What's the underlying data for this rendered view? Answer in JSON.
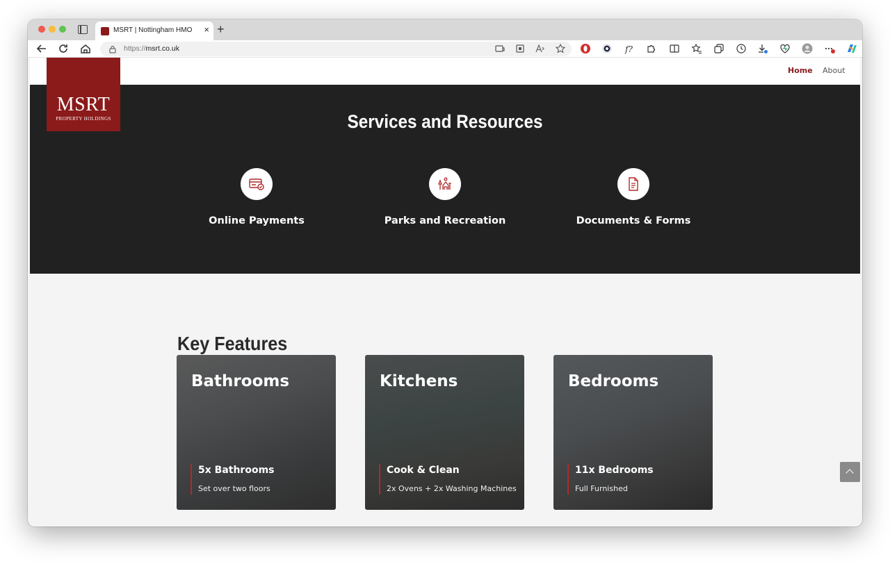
{
  "browser": {
    "tab_title": "MSRT | Nottingham HMO",
    "tab_close": "×",
    "new_tab": "+",
    "url_scheme": "https://",
    "url_host": "msrt.co.uk"
  },
  "site": {
    "logo_main": "MSRT",
    "logo_sub": "PROPERTY HOLDINGS",
    "nav": {
      "home": "Home",
      "about": "About"
    },
    "services": {
      "title": "Services and Resources",
      "items": [
        {
          "label": "Online Payments",
          "icon": "credit-card-icon"
        },
        {
          "label": "Parks and Recreation",
          "icon": "park-icon"
        },
        {
          "label": "Documents & Forms",
          "icon": "document-icon"
        }
      ]
    },
    "features": {
      "title": "Key Features",
      "cards": [
        {
          "title": "Bathrooms",
          "heading": "5x Bathrooms",
          "subtitle": "Set over two floors"
        },
        {
          "title": "Kitchens",
          "heading": "Cook & Clean",
          "subtitle": "2x Ovens + 2x Washing Machines"
        },
        {
          "title": "Bedrooms",
          "heading": "11x Bedrooms",
          "subtitle": "Full Furnished"
        }
      ]
    }
  },
  "colors": {
    "brand": "#8b1a1a",
    "dark_band": "#212121",
    "page_bg": "#f4f4f4"
  }
}
